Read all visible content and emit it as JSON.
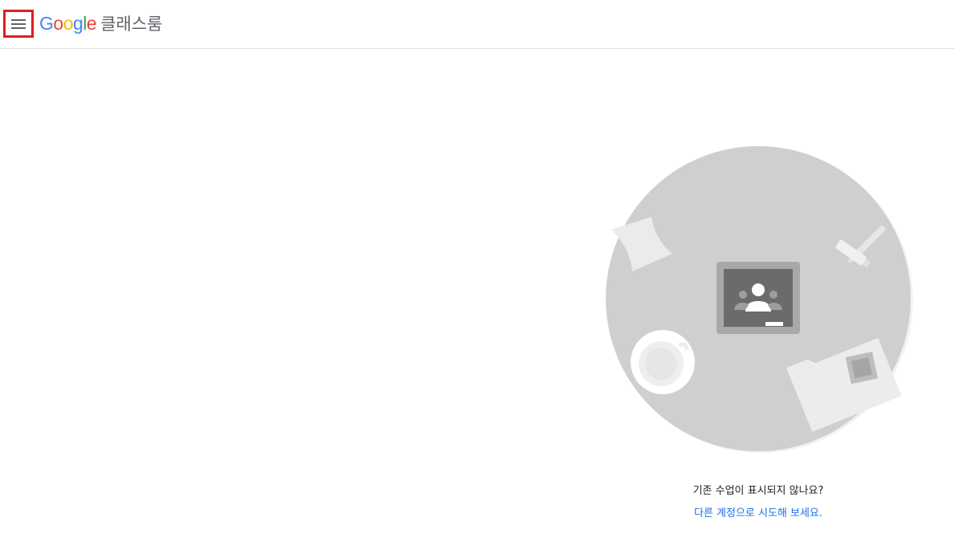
{
  "header": {
    "menu_icon": "hamburger-menu-icon",
    "logo": {
      "letters": [
        {
          "char": "G",
          "color": "#4285F4"
        },
        {
          "char": "o",
          "color": "#EA4335"
        },
        {
          "char": "o",
          "color": "#FBBC05"
        },
        {
          "char": "g",
          "color": "#4285F4"
        },
        {
          "char": "l",
          "color": "#34A853"
        },
        {
          "char": "e",
          "color": "#EA4335"
        }
      ],
      "product": "클래스룸"
    },
    "highlight_color": "#e21b23"
  },
  "empty_state": {
    "illustration_icon": "classroom-desk-illustration",
    "message": "기존 수업이 표시되지 않나요?",
    "link": "다른 계정으로 시도해 보세요."
  },
  "colors": {
    "link": "#1a73e8",
    "illustration_gray": "#cfcfcf"
  }
}
